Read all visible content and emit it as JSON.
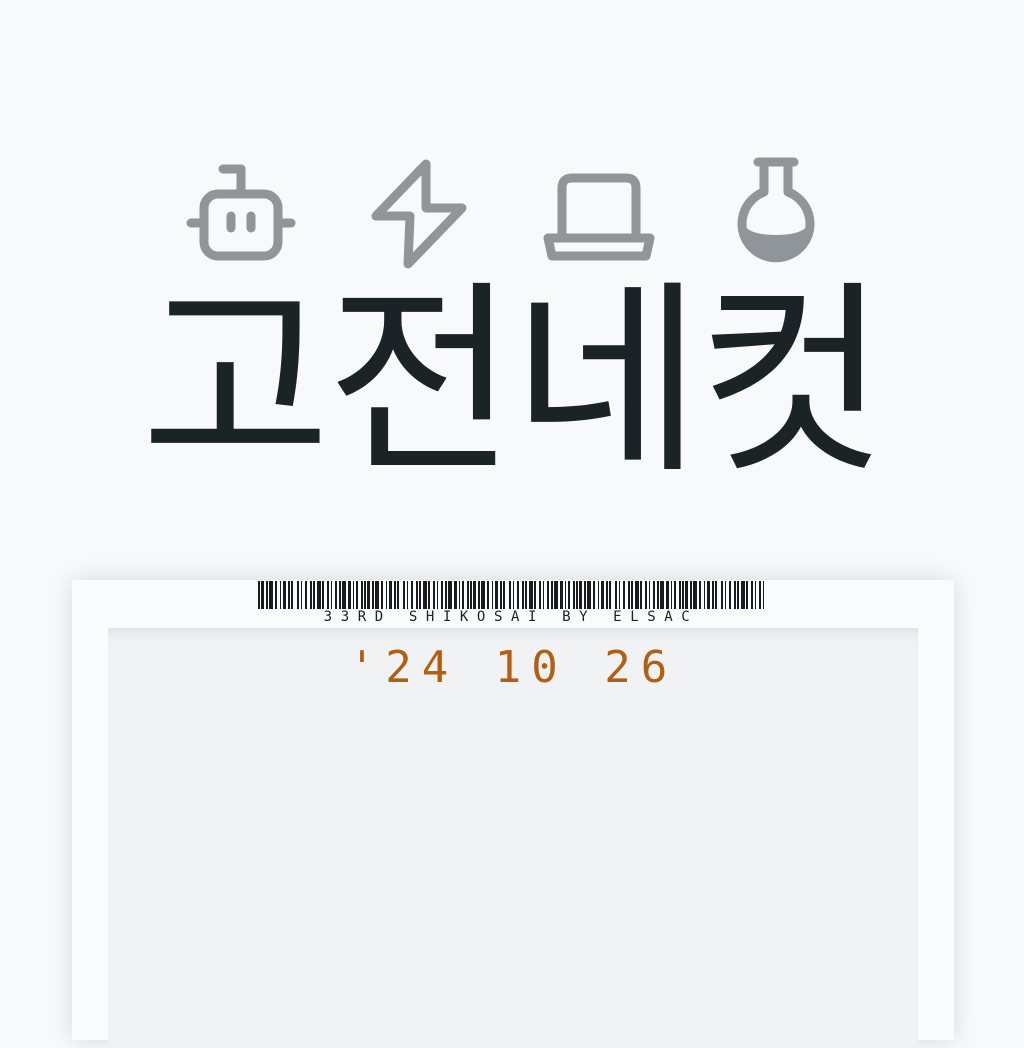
{
  "icons": [
    "robot-icon",
    "lightning-icon",
    "laptop-icon",
    "flask-icon"
  ],
  "colors": {
    "icon": "#8f9599",
    "title": "#1b2326",
    "date": "#b35f13",
    "background": "#f8f9fa"
  },
  "title": "고전네컷",
  "ticket": {
    "caption": "33RD SHIKOSAI BY ELSAC",
    "date": "'24 10 26"
  }
}
